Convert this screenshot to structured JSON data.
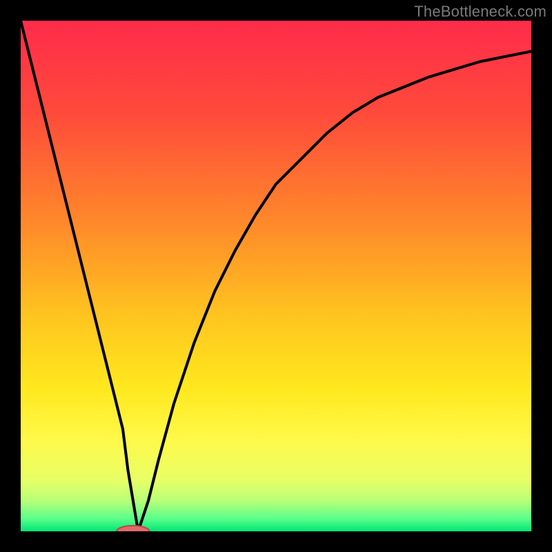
{
  "watermark": "TheBottleneck.com",
  "colors": {
    "frame": "#000000",
    "curve": "#000000",
    "marker_fill": "#e26a6a",
    "marker_stroke": "#b94444",
    "gradient_stops": [
      {
        "offset": 0.0,
        "color": "#ff2b4a"
      },
      {
        "offset": 0.18,
        "color": "#ff4a3b"
      },
      {
        "offset": 0.4,
        "color": "#ff8a2a"
      },
      {
        "offset": 0.58,
        "color": "#ffc51f"
      },
      {
        "offset": 0.72,
        "color": "#ffe81e"
      },
      {
        "offset": 0.82,
        "color": "#fff94a"
      },
      {
        "offset": 0.9,
        "color": "#e8ff66"
      },
      {
        "offset": 0.94,
        "color": "#b8ff78"
      },
      {
        "offset": 0.975,
        "color": "#5bff8a"
      },
      {
        "offset": 1.0,
        "color": "#00e676"
      }
    ]
  },
  "chart_data": {
    "type": "line",
    "title": "",
    "xlabel": "",
    "ylabel": "",
    "xlim": [
      0,
      100
    ],
    "ylim": [
      0,
      100
    ],
    "grid": false,
    "legend": false,
    "series": [
      {
        "name": "left-descent",
        "x": [
          0,
          2,
          4,
          6,
          8,
          10,
          12,
          14,
          16,
          18,
          20,
          21,
          22,
          23
        ],
        "values": [
          100,
          92,
          84,
          76,
          68,
          60,
          52,
          44,
          36,
          28,
          20,
          12,
          6,
          0
        ]
      },
      {
        "name": "right-ascent",
        "x": [
          23,
          25,
          27,
          30,
          34,
          38,
          42,
          46,
          50,
          55,
          60,
          65,
          70,
          75,
          80,
          85,
          90,
          95,
          100
        ],
        "values": [
          0,
          6,
          14,
          25,
          37,
          47,
          55,
          62,
          68,
          73,
          78,
          82,
          85,
          87,
          89,
          90.5,
          92,
          93,
          94
        ]
      }
    ],
    "marker": {
      "x": 22,
      "y": 0,
      "rx_percent": 3.2,
      "ry_percent": 1.1
    }
  }
}
